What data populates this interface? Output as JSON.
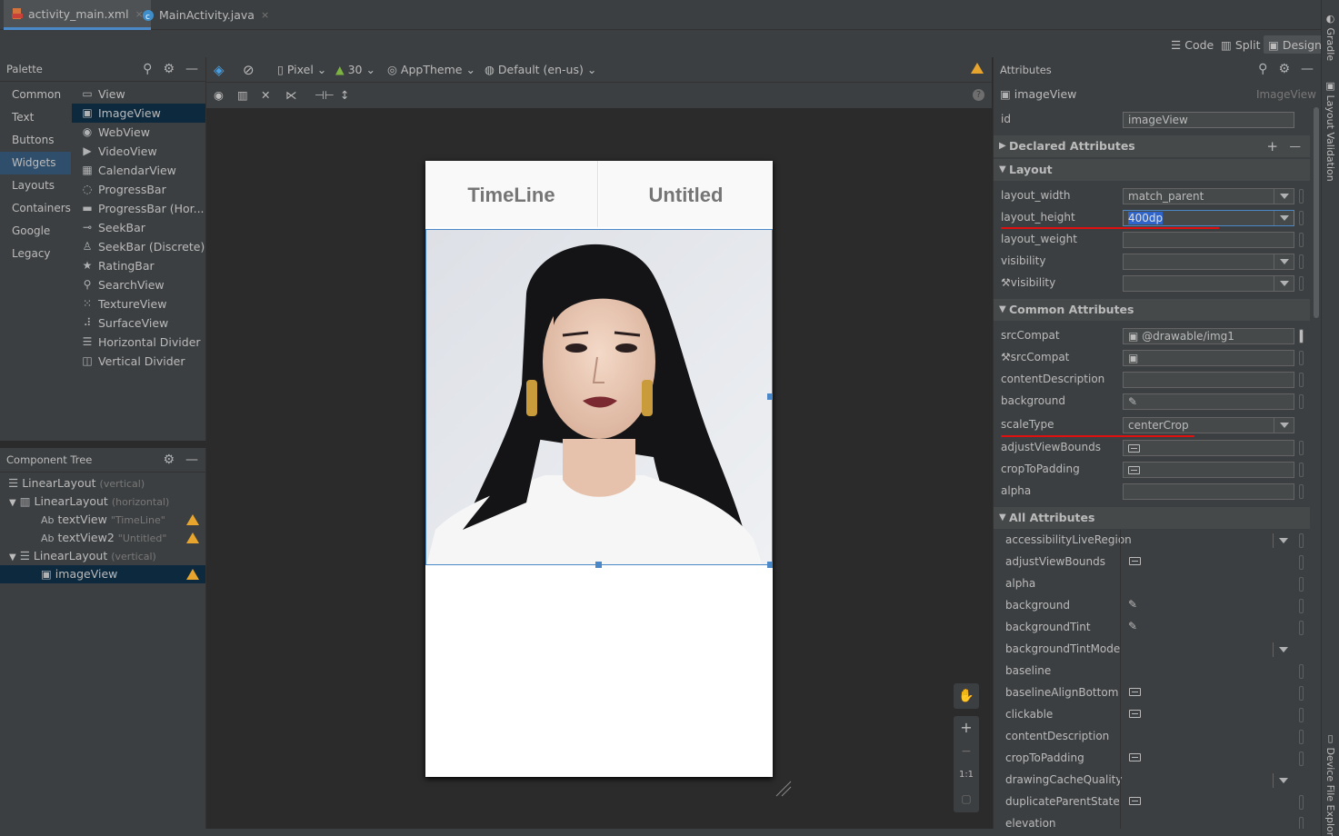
{
  "tabs": [
    {
      "label": "activity_main.xml",
      "close": "×"
    },
    {
      "label": "MainActivity.java",
      "close": "×"
    }
  ],
  "modes": {
    "code": "Code",
    "split": "Split",
    "design": "Design"
  },
  "palette": {
    "title": "Palette",
    "categories": [
      "Common",
      "Text",
      "Buttons",
      "Widgets",
      "Layouts",
      "Containers",
      "Google",
      "Legacy"
    ],
    "items": [
      "View",
      "ImageView",
      "WebView",
      "VideoView",
      "CalendarView",
      "ProgressBar",
      "ProgressBar (Hor...",
      "SeekBar",
      "SeekBar (Discrete)",
      "RatingBar",
      "SearchView",
      "TextureView",
      "SurfaceView",
      "Horizontal Divider",
      "Vertical Divider"
    ]
  },
  "component_tree": {
    "title": "Component Tree",
    "rows": [
      {
        "name": "LinearLayout",
        "sub": "(vertical)"
      },
      {
        "name": "LinearLayout",
        "sub": "(horizontal)"
      },
      {
        "prefix": "Ab",
        "name": "textView",
        "sub": "\"TimeLine\""
      },
      {
        "prefix": "Ab",
        "name": "textView2",
        "sub": "\"Untitled\""
      },
      {
        "name": "LinearLayout",
        "sub": "(vertical)"
      },
      {
        "name": "imageView",
        "sub": ""
      }
    ]
  },
  "toolbar": {
    "device": "Pixel",
    "api": "30",
    "theme": "AppTheme",
    "locale": "Default (en-us)"
  },
  "preview": {
    "tab1": "TimeLine",
    "tab2": "Untitled"
  },
  "zoom": {
    "plus": "+",
    "minus": "−",
    "ratio": "1:1"
  },
  "attributes": {
    "title": "Attributes",
    "component": "imageView",
    "component_type": "ImageView",
    "id_label": "id",
    "id_value": "imageView",
    "sections": {
      "declared": "Declared Attributes",
      "layout": "Layout",
      "common": "Common Attributes",
      "all": "All Attributes"
    },
    "layout": [
      {
        "label": "layout_width",
        "value": "match_parent"
      },
      {
        "label": "layout_height",
        "value": "400dp"
      },
      {
        "label": "layout_weight",
        "value": ""
      },
      {
        "label": "visibility",
        "value": ""
      },
      {
        "label": "visibility",
        "value": ""
      }
    ],
    "common": [
      {
        "label": "srcCompat",
        "value": "@drawable/img1"
      },
      {
        "label": "srcCompat",
        "value": ""
      },
      {
        "label": "contentDescription",
        "value": ""
      },
      {
        "label": "background",
        "value": ""
      },
      {
        "label": "scaleType",
        "value": "centerCrop"
      },
      {
        "label": "adjustViewBounds",
        "value": ""
      },
      {
        "label": "cropToPadding",
        "value": ""
      },
      {
        "label": "alpha",
        "value": ""
      }
    ],
    "all": [
      "accessibilityLiveRegion",
      "adjustViewBounds",
      "alpha",
      "background",
      "backgroundTint",
      "backgroundTintMode",
      "baseline",
      "baselineAlignBottom",
      "clickable",
      "contentDescription",
      "cropToPadding",
      "drawingCacheQuality",
      "duplicateParentState",
      "elevation"
    ]
  },
  "side_strip": {
    "gradle": "Gradle",
    "layout_validation": "Layout Validation",
    "device_file": "Device File Explorer"
  },
  "colors": {
    "accent": "#4a88c7",
    "highlight": "#e01010",
    "warning": "#e7a52e"
  }
}
